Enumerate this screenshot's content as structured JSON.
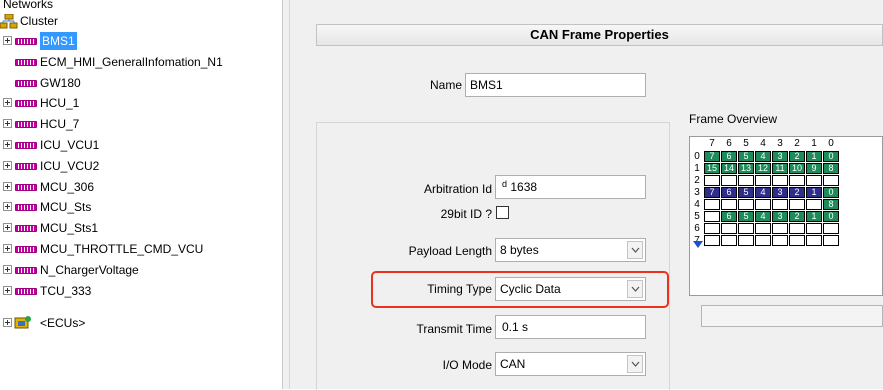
{
  "tree": {
    "root_label": "Networks",
    "cluster_label": "Cluster",
    "items": [
      {
        "label": "BMS1",
        "expandable": true,
        "selected": true
      },
      {
        "label": "ECM_HMI_GeneralInfomation_N1",
        "expandable": false,
        "selected": false
      },
      {
        "label": "GW180",
        "expandable": false,
        "selected": false
      },
      {
        "label": "HCU_1",
        "expandable": true,
        "selected": false
      },
      {
        "label": "HCU_7",
        "expandable": true,
        "selected": false
      },
      {
        "label": "ICU_VCU1",
        "expandable": true,
        "selected": false
      },
      {
        "label": "ICU_VCU2",
        "expandable": true,
        "selected": false
      },
      {
        "label": "MCU_306",
        "expandable": true,
        "selected": false
      },
      {
        "label": "MCU_Sts",
        "expandable": true,
        "selected": false
      },
      {
        "label": "MCU_Sts1",
        "expandable": true,
        "selected": false
      },
      {
        "label": "MCU_THROTTLE_CMD_VCU",
        "expandable": true,
        "selected": false
      },
      {
        "label": "N_ChargerVoltage",
        "expandable": true,
        "selected": false
      },
      {
        "label": "TCU_333",
        "expandable": true,
        "selected": false
      }
    ],
    "ecus_label": "<ECUs>"
  },
  "panel": {
    "title": "CAN Frame Properties",
    "name_label": "Name",
    "name_value": "BMS1",
    "arbitration_label": "Arbitration Id",
    "arbitration_prefix": "d",
    "arbitration_value": "1638",
    "ext_id_label": "29bit ID ?",
    "ext_id_checked": false,
    "payload_label": "Payload Length",
    "payload_value": "8 bytes",
    "timing_label": "Timing Type",
    "timing_value": "Cyclic Data",
    "transmit_label": "Transmit Time",
    "transmit_value": "0.1 s",
    "io_label": "I/O Mode",
    "io_value": "CAN"
  },
  "overview": {
    "title": "Frame Overview",
    "bit_headers": [
      "7",
      "6",
      "5",
      "4",
      "3",
      "2",
      "1",
      "0"
    ],
    "row_numbers": [
      "0",
      "1",
      "2",
      "3",
      "4",
      "5",
      "6",
      "7"
    ],
    "rows": [
      [
        "7",
        "6",
        "5",
        "4",
        "3",
        "2",
        "1",
        "0"
      ],
      [
        "15",
        "14",
        "13",
        "12",
        "11",
        "10",
        "9",
        "8"
      ],
      [
        "",
        "",
        "",
        "",
        "",
        "",
        "",
        ""
      ],
      [
        "7",
        "6",
        "5",
        "4",
        "3",
        "2",
        "1",
        "0"
      ],
      [
        "",
        "",
        "",
        "",
        "",
        "",
        "",
        "8"
      ],
      [
        "",
        "6",
        "5",
        "4",
        "3",
        "2",
        "1",
        "0"
      ],
      [
        "",
        "",
        "",
        "",
        "",
        "",
        "",
        ""
      ],
      [
        "",
        "",
        "",
        "",
        "",
        "",
        "",
        ""
      ]
    ],
    "fills": [
      [
        "g2",
        "g2",
        "g2",
        "g2",
        "g2",
        "g2",
        "g2",
        "g2"
      ],
      [
        "g2",
        "g2",
        "g2",
        "g2",
        "g2",
        "g2",
        "g2",
        "g2"
      ],
      [
        "",
        "",
        "",
        "",
        "",
        "",
        "",
        ""
      ],
      [
        "g1",
        "g1",
        "g1",
        "g1",
        "g1",
        "g1",
        "g1",
        "g2"
      ],
      [
        "",
        "",
        "",
        "",
        "",
        "",
        "",
        "g2"
      ],
      [
        "",
        "g2",
        "g2",
        "g2",
        "g2",
        "g2",
        "g2",
        "g2"
      ],
      [
        "",
        "",
        "",
        "",
        "",
        "",
        "",
        ""
      ],
      [
        "",
        "",
        "",
        "",
        "",
        "",
        "",
        ""
      ]
    ]
  },
  "colors": {
    "highlight": "#e8331f",
    "selection": "#3399ff",
    "grid_blue": "#2e2e8a",
    "grid_green": "#1f8a5a"
  }
}
